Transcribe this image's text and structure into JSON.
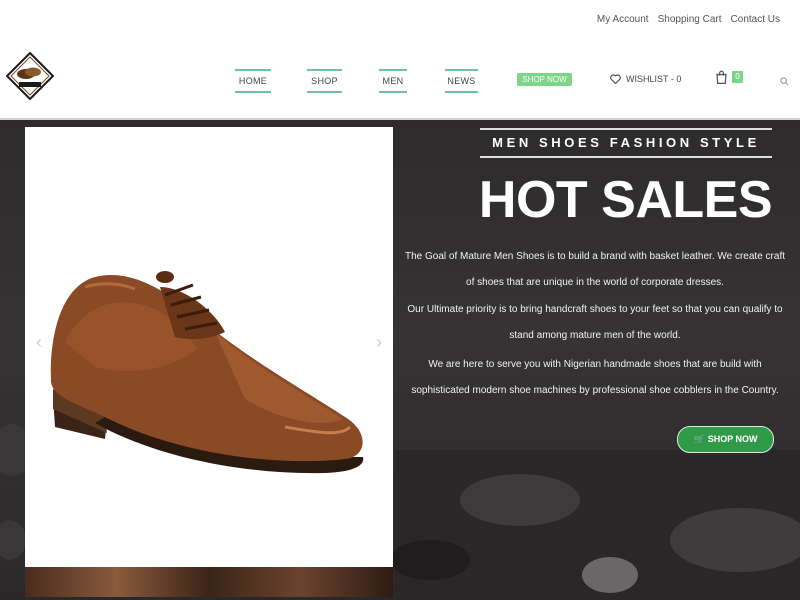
{
  "topbar": {
    "links": [
      "My Account",
      "Shopping Cart",
      "Contact Us"
    ]
  },
  "header": {
    "logo_alt": "MATURE",
    "nav": [
      "HOME",
      "SHOP",
      "MEN",
      "NEWS"
    ],
    "shop_now": "SHOP NOW",
    "wishlist": "WISHLIST - 0",
    "cart_count": "0"
  },
  "hero": {
    "subtitle": "MEN SHOES FASHION STYLE",
    "title": "HOT SALES",
    "paragraphs": [
      "The Goal of Mature Men Shoes is to build a brand with basket leather. We create craft of shoes that are unique in the world of corporate dresses.",
      "Our Ultimate priority is to bring handcraft shoes to your feet so that you can qualify to stand among mature men of the world.",
      "We are here to serve you with Nigerian handmade shoes that are build with sophisticated modern shoe machines by professional shoe cobblers in the Country."
    ],
    "cta": "SHOP NOW",
    "arrow_prev": "‹",
    "arrow_next": "›"
  },
  "colors": {
    "accent": "#6fbfa9",
    "shop_now_bg": "#7dd58a",
    "cta_bg": "#2f9a48",
    "hero_bg": "#2d2b2c"
  }
}
